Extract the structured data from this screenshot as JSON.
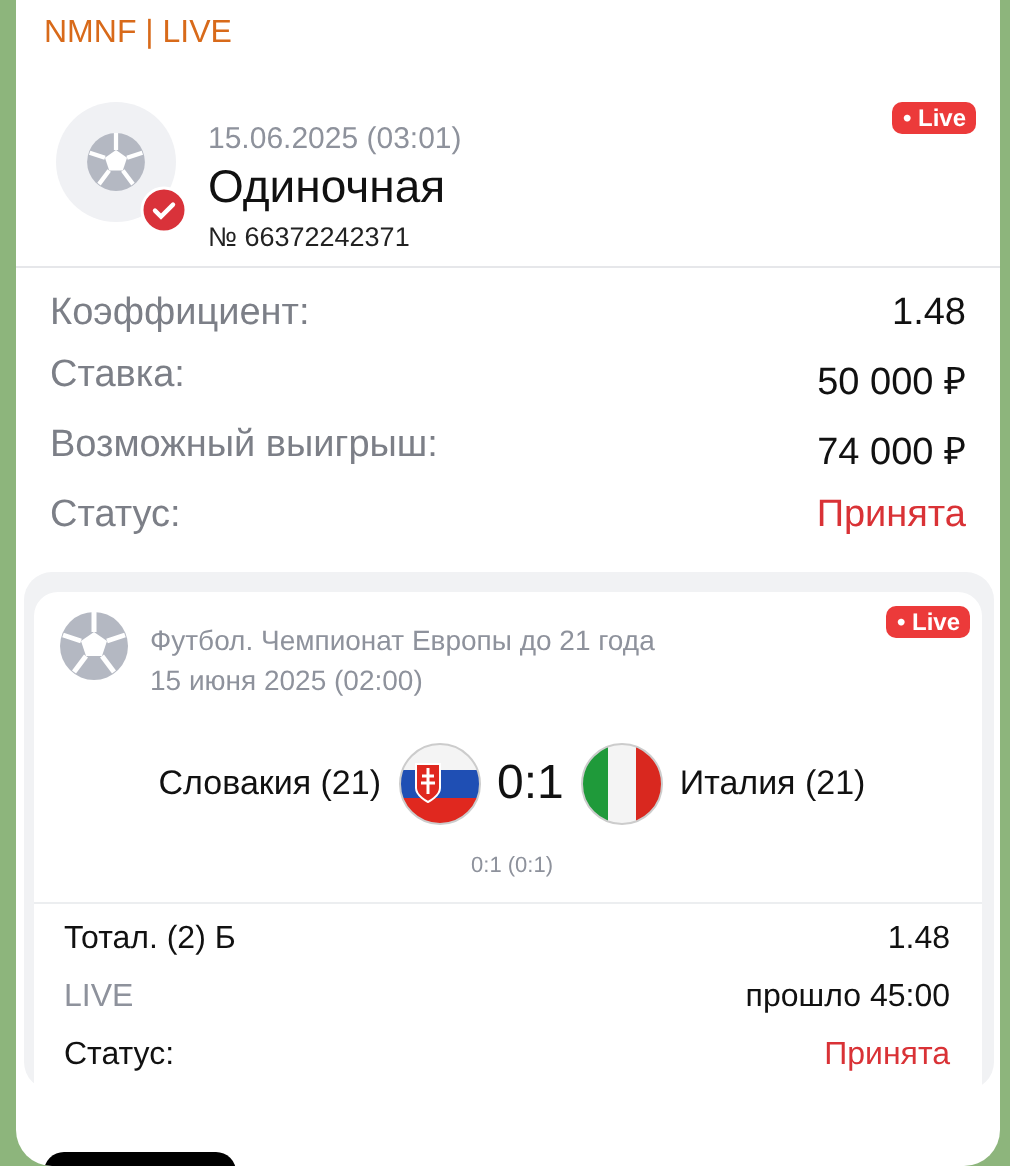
{
  "channel": "NMNF | LIVE",
  "ticket": {
    "date": "15.06.2025 (03:01)",
    "type": "Одиночная",
    "number": "№ 66372242371",
    "badge": "• Live",
    "confirmed": true
  },
  "summary": [
    {
      "label": "Коэффициент:",
      "value": "1.48",
      "kind": "plain"
    },
    {
      "label": "Ставка:",
      "value": "50 000 ₽",
      "kind": "plain"
    },
    {
      "label": "Возможный выигрыш:",
      "value": "74 000 ₽",
      "kind": "plain"
    },
    {
      "label": "Статус:",
      "value": "Принята",
      "kind": "status"
    }
  ],
  "event": {
    "league": "Футбол. Чемпионат Европы до 21 года",
    "date": "15 июня 2025 (02:00)",
    "badge": "• Live",
    "home": "Словакия (21)",
    "away": "Италия (21)",
    "score": "0:1",
    "halftime": "0:1 (0:1)"
  },
  "bet_rows": [
    {
      "label": "Тотал. (2) Б",
      "value": "1.48",
      "kind": "bet"
    },
    {
      "label": "LIVE",
      "value": "прошло 45:00",
      "kind": "muted"
    },
    {
      "label": "Статус:",
      "value": "Принята",
      "kind": "status"
    }
  ]
}
